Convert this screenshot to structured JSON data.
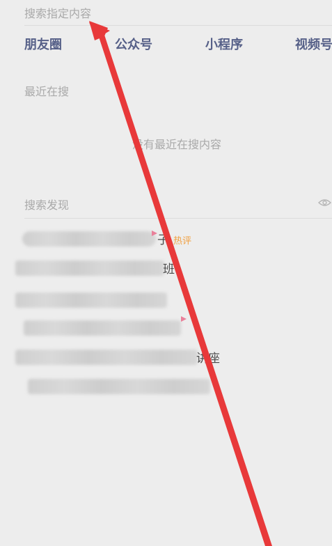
{
  "search": {
    "header": "搜索指定内容"
  },
  "categories": [
    {
      "label": "朋友圈"
    },
    {
      "label": "公众号"
    },
    {
      "label": "小程序"
    },
    {
      "label": "视频号"
    }
  ],
  "recent": {
    "title": "最近在搜",
    "empty_text": "没有最近在搜内容"
  },
  "discover": {
    "title": "搜索发现",
    "toggle_icon": "eye-icon",
    "items": [
      {
        "visible_text": "子",
        "badge": "热评"
      },
      {
        "visible_text": "班",
        "badge": ""
      },
      {
        "visible_text": "",
        "badge": ""
      },
      {
        "visible_text": "",
        "badge": ""
      },
      {
        "visible_text": "讲座",
        "badge": ""
      },
      {
        "visible_text": "",
        "badge": ""
      }
    ]
  },
  "colors": {
    "background": "#ededed",
    "category_text": "#566088",
    "muted_text": "#a9a9a9",
    "hot_badge": "#f0a040",
    "annotation_arrow": "#e8393a"
  },
  "annotation": {
    "icon": "red-arrow-annotation"
  }
}
